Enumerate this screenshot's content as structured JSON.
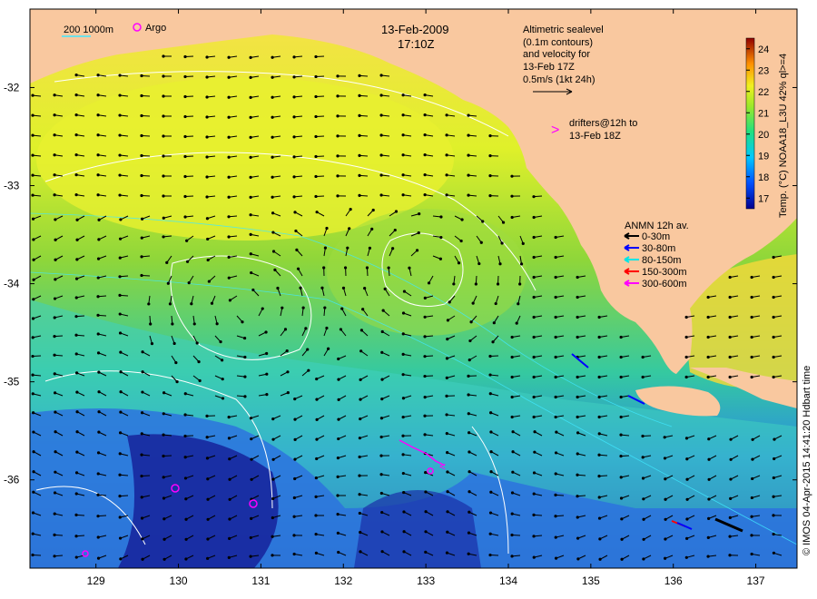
{
  "title": {
    "date": "13-Feb-2009",
    "time": "17:10Z"
  },
  "altimetry_note": {
    "line1": "Altimetric sealevel",
    "line2": "(0.1m contours)",
    "line3": "and velocity for",
    "line4": "13-Feb 17Z",
    "line5": "0.5m/s (1kt 24h)"
  },
  "drifters_note": {
    "symbol": ">",
    "line1": "drifters@12h to",
    "line2": "13-Feb 18Z"
  },
  "bathy_legend": {
    "depths": "200  1000m",
    "argo": "Argo"
  },
  "anmn_legend": {
    "title": "ANMN 12h av.",
    "items": [
      {
        "label": "0-30m",
        "color": "#000000"
      },
      {
        "label": "30-80m",
        "color": "#0000ff"
      },
      {
        "label": "80-150m",
        "color": "#00e5e5"
      },
      {
        "label": "150-300m",
        "color": "#ff0000"
      },
      {
        "label": "300-600m",
        "color": "#ff00ff"
      }
    ]
  },
  "colorbar": {
    "label": "Temp. (°C) NOAA18_L3U 42% ql>=4",
    "ticks": [
      "17",
      "18",
      "19",
      "20",
      "21",
      "22",
      "23",
      "24"
    ],
    "range": [
      16.5,
      24.5
    ]
  },
  "credit": "© IMOS 04-Apr-2015 14:41:20 Hdbart time",
  "axes": {
    "x_ticks": [
      "129",
      "130",
      "131",
      "132",
      "133",
      "134",
      "135",
      "136",
      "137"
    ],
    "y_ticks": [
      "-32",
      "-33",
      "-34",
      "-35",
      "-36"
    ],
    "lon_range": [
      128.2,
      137.5
    ],
    "lat_range": [
      -36.9,
      -31.2
    ]
  },
  "colors": {
    "land": "#f9c89f",
    "contour": "#ffffff",
    "drifter": "#ff00ff"
  }
}
